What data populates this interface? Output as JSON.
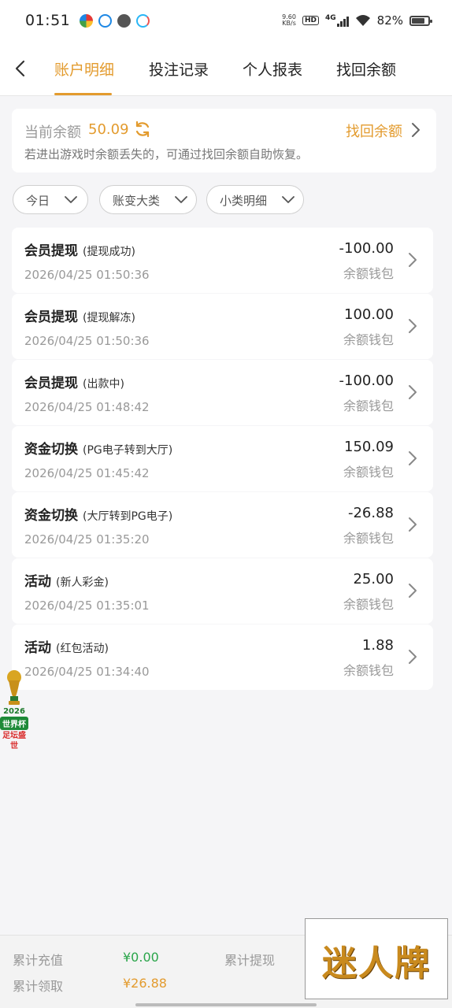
{
  "status_bar": {
    "time": "01:51",
    "net_speed_value": "9.60",
    "net_speed_unit": "KB/s",
    "hd": "HD",
    "network": "4G",
    "battery": "82%",
    "battery_level": 0.82
  },
  "nav": {
    "tabs": [
      {
        "label": "账户明细",
        "active": true
      },
      {
        "label": "投注记录",
        "active": false
      },
      {
        "label": "个人报表",
        "active": false
      },
      {
        "label": "找回余额",
        "active": false
      }
    ]
  },
  "balance": {
    "label": "当前余额",
    "value": "50.09",
    "recover_label": "找回余额",
    "tip": "若进出游戏时余额丢失的，可通过找回余额自助恢复。"
  },
  "filters": [
    {
      "label": "今日"
    },
    {
      "label": "账变大类"
    },
    {
      "label": "小类明细"
    }
  ],
  "records": [
    {
      "title": "会员提现",
      "sub": "(提现成功)",
      "date": "2026/04/25 01:50:36",
      "amount": "-100.00",
      "wallet": "余额钱包"
    },
    {
      "title": "会员提现",
      "sub": "(提现解冻)",
      "date": "2026/04/25 01:50:36",
      "amount": "100.00",
      "wallet": "余额钱包"
    },
    {
      "title": "会员提现",
      "sub": "(出款中)",
      "date": "2026/04/25 01:48:42",
      "amount": "-100.00",
      "wallet": "余额钱包"
    },
    {
      "title": "资金切换",
      "sub": "(PG电子转到大厅)",
      "date": "2026/04/25 01:45:42",
      "amount": "150.09",
      "wallet": "余额钱包"
    },
    {
      "title": "资金切换",
      "sub": "(大厅转到PG电子)",
      "date": "2026/04/25 01:35:20",
      "amount": "-26.88",
      "wallet": "余额钱包"
    },
    {
      "title": "活动",
      "sub": "(新人彩金)",
      "date": "2026/04/25 01:35:01",
      "amount": "25.00",
      "wallet": "余额钱包"
    },
    {
      "title": "活动",
      "sub": "(红包活动)",
      "date": "2026/04/25 01:34:40",
      "amount": "1.88",
      "wallet": "余额钱包"
    }
  ],
  "promo_badge": {
    "year": "2026",
    "name": "世界杯",
    "slogan": "足坛盛世"
  },
  "footer": {
    "total_recharge_label": "累计充值",
    "total_recharge_value": "¥0.00",
    "total_withdraw_label": "累计提现",
    "total_claim_label": "累计领取",
    "total_claim_value": "¥26.88"
  },
  "watermark": "迷人牌",
  "colors": {
    "accent": "#e39b2e",
    "green": "#2aa54a"
  }
}
